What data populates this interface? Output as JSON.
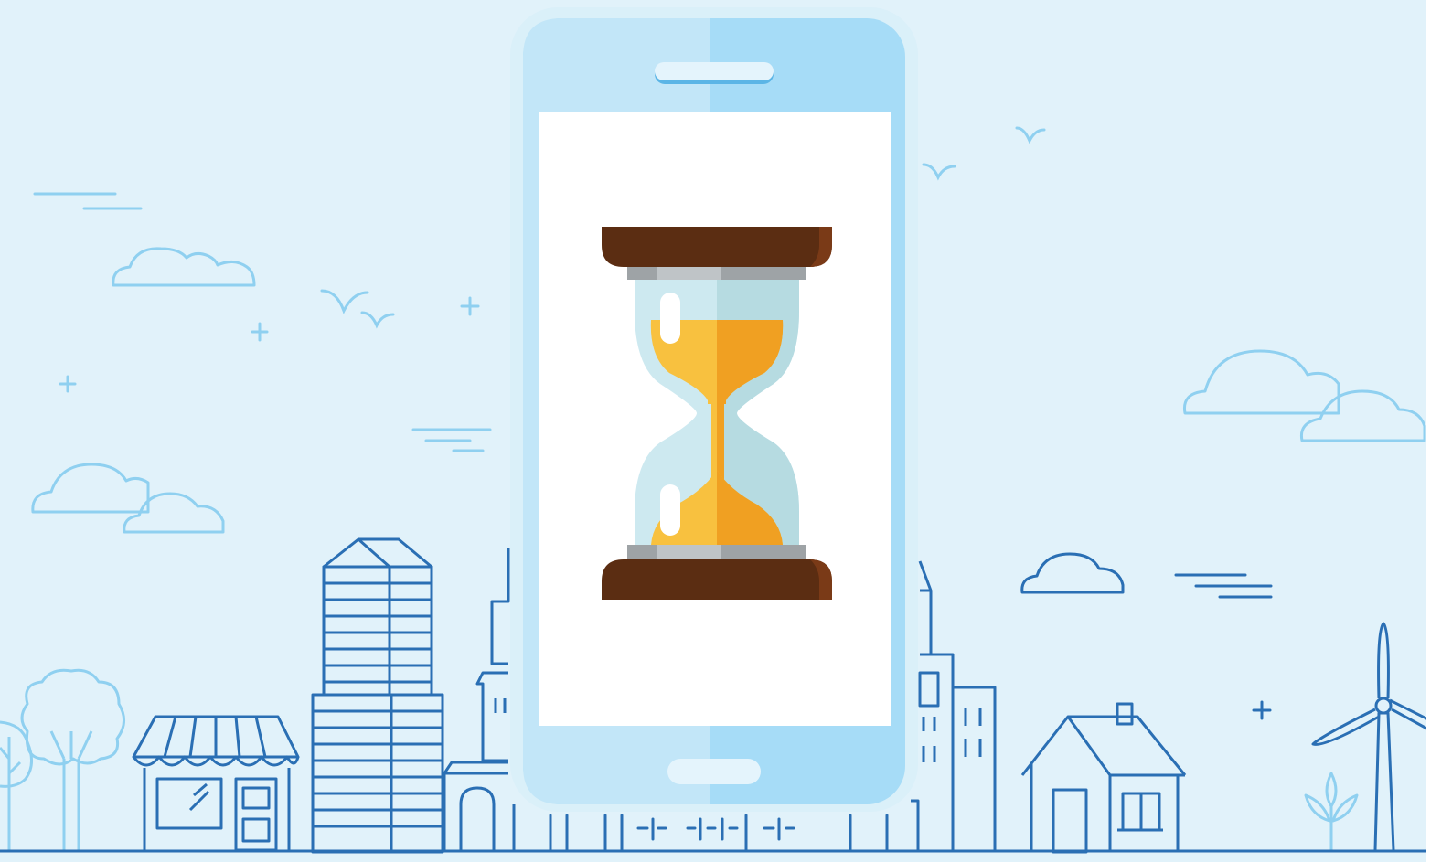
{
  "scene": {
    "subject": "hourglass-icon",
    "device": "smartphone-icon",
    "colors": {
      "background": "#e1f2fa",
      "outline_dark": "#2a6fb4",
      "outline_light": "#8fd0f0",
      "phone_body": "#a6dcf7",
      "phone_body_light": "#c2e6f8",
      "screen": "#ffffff",
      "hourglass_cap": "#5b2d12",
      "hourglass_cap_shade": "#7a3a17",
      "glass": "#cde9f0",
      "sand": "#f8c13f",
      "sand_shade": "#f0a022",
      "neck_metal": "#9ea3a6"
    }
  }
}
